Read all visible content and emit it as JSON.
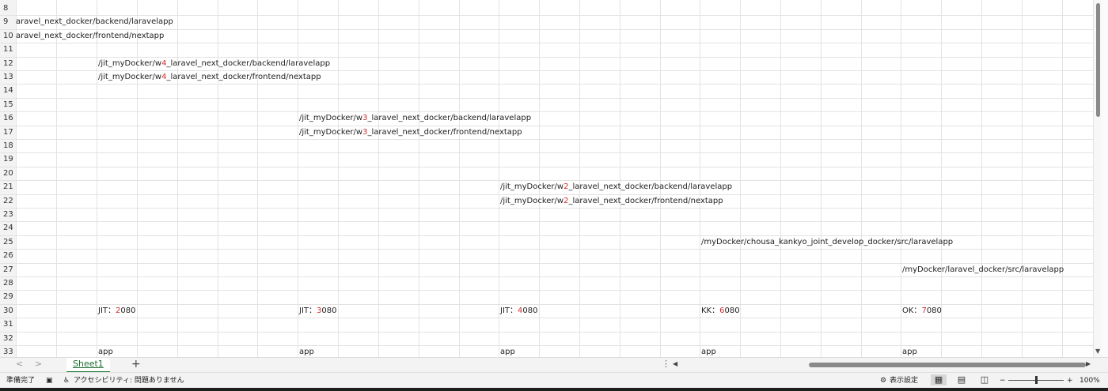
{
  "rows": [
    {
      "num": "8",
      "cells": []
    },
    {
      "num": "9",
      "cells": [
        {
          "col": 0,
          "parts": [
            {
              "text": "aravel_next_docker/backend/laravelapp"
            }
          ]
        }
      ]
    },
    {
      "num": "10",
      "cells": [
        {
          "col": 0,
          "parts": [
            {
              "text": "aravel_next_docker/frontend/nextapp"
            }
          ]
        }
      ]
    },
    {
      "num": "11",
      "cells": []
    },
    {
      "num": "12",
      "cells": [
        {
          "col": 1,
          "parts": [
            {
              "text": "/jit_myDocker/w"
            },
            {
              "text": "4",
              "red": true
            },
            {
              "text": "_laravel_next_docker/backend/laravelapp"
            }
          ]
        }
      ]
    },
    {
      "num": "13",
      "cells": [
        {
          "col": 1,
          "parts": [
            {
              "text": "/jit_myDocker/w"
            },
            {
              "text": "4",
              "red": true
            },
            {
              "text": "_laravel_next_docker/frontend/nextapp"
            }
          ]
        }
      ]
    },
    {
      "num": "14",
      "cells": []
    },
    {
      "num": "15",
      "cells": []
    },
    {
      "num": "16",
      "cells": [
        {
          "col": 2,
          "parts": [
            {
              "text": "/jit_myDocker/w"
            },
            {
              "text": "3",
              "red": true
            },
            {
              "text": "_laravel_next_docker/backend/laravelapp"
            }
          ]
        }
      ]
    },
    {
      "num": "17",
      "cells": [
        {
          "col": 2,
          "parts": [
            {
              "text": "/jit_myDocker/w"
            },
            {
              "text": "3",
              "red": true
            },
            {
              "text": "_laravel_next_docker/frontend/nextapp"
            }
          ]
        }
      ]
    },
    {
      "num": "18",
      "cells": []
    },
    {
      "num": "19",
      "cells": []
    },
    {
      "num": "20",
      "cells": []
    },
    {
      "num": "21",
      "cells": [
        {
          "col": 3,
          "parts": [
            {
              "text": "/jit_myDocker/w"
            },
            {
              "text": "2",
              "red": true
            },
            {
              "text": "_laravel_next_docker/backend/laravelapp"
            }
          ]
        }
      ]
    },
    {
      "num": "22",
      "cells": [
        {
          "col": 3,
          "parts": [
            {
              "text": "/jit_myDocker/w"
            },
            {
              "text": "2",
              "red": true
            },
            {
              "text": "_laravel_next_docker/frontend/nextapp"
            }
          ]
        }
      ]
    },
    {
      "num": "23",
      "cells": []
    },
    {
      "num": "24",
      "cells": []
    },
    {
      "num": "25",
      "cells": [
        {
          "col": 4,
          "parts": [
            {
              "text": "/myDocker/chousa_kankyo_joint_develop_docker/src/laravelapp"
            }
          ]
        }
      ]
    },
    {
      "num": "26",
      "cells": []
    },
    {
      "num": "27",
      "cells": [
        {
          "col": 5,
          "parts": [
            {
              "text": "/myDocker/laravel_docker/src/laravelapp"
            }
          ]
        }
      ]
    },
    {
      "num": "28",
      "cells": []
    },
    {
      "num": "29",
      "cells": []
    },
    {
      "num": "30",
      "cells": [
        {
          "col": 1,
          "parts": [
            {
              "text": "JIT："
            },
            {
              "text": "2",
              "red": true
            },
            {
              "text": "080"
            }
          ]
        },
        {
          "col": 2,
          "parts": [
            {
              "text": "JIT："
            },
            {
              "text": "3",
              "red": true
            },
            {
              "text": "080"
            }
          ]
        },
        {
          "col": 3,
          "parts": [
            {
              "text": "JIT："
            },
            {
              "text": "4",
              "red": true
            },
            {
              "text": "080"
            }
          ]
        },
        {
          "col": 4,
          "parts": [
            {
              "text": "KK："
            },
            {
              "text": "6",
              "red": true
            },
            {
              "text": "080"
            }
          ]
        },
        {
          "col": 5,
          "parts": [
            {
              "text": "OK："
            },
            {
              "text": "7",
              "red": true
            },
            {
              "text": "080"
            }
          ]
        }
      ]
    },
    {
      "num": "31",
      "cells": []
    },
    {
      "num": "32",
      "cells": []
    },
    {
      "num": "33",
      "cells": [
        {
          "col": 1,
          "parts": [
            {
              "text": "app"
            }
          ]
        },
        {
          "col": 2,
          "parts": [
            {
              "text": "app"
            }
          ]
        },
        {
          "col": 3,
          "parts": [
            {
              "text": "app"
            }
          ]
        },
        {
          "col": 4,
          "parts": [
            {
              "text": "app"
            }
          ]
        },
        {
          "col": 5,
          "parts": [
            {
              "text": "app"
            }
          ]
        }
      ]
    }
  ],
  "tabbar": {
    "prev_glyph": "<",
    "next_glyph": ">",
    "sheet_tab": "Sheet1",
    "add_sheet": "+",
    "hscroll_menu": "⋮",
    "hscroll_left": "◀",
    "hscroll_right": "▶"
  },
  "status": {
    "ready": "準備完了",
    "accessibility": "アクセシビリティ: 問題ありません",
    "display_settings": "表示設定",
    "zoom_minus": "−",
    "zoom_plus": "+",
    "zoom_level": "100%"
  },
  "colors": {
    "accent_red": "#d12c2c",
    "sheet_tab_green": "#1e6f2f"
  }
}
